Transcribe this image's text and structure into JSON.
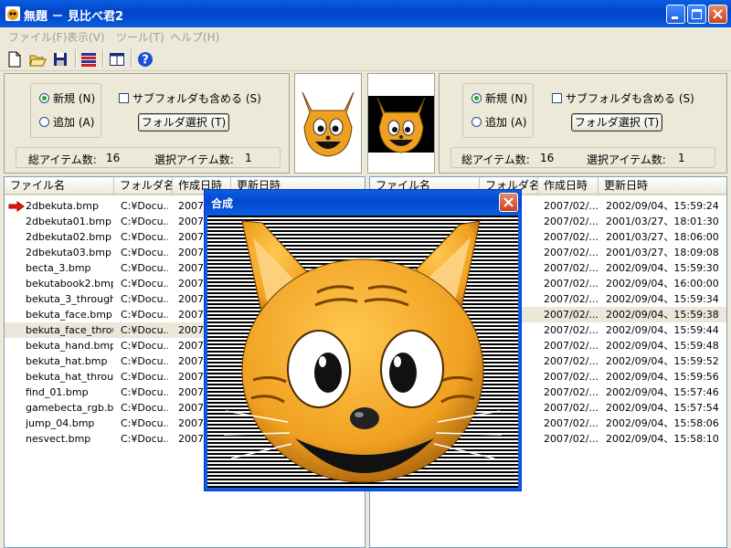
{
  "window": {
    "title": "無題 － 見比べ君2"
  },
  "menu": [
    {
      "label": "ファイル(F)"
    },
    {
      "label": "表示(V)"
    },
    {
      "label": "ツール(T)"
    },
    {
      "label": "ヘルプ(H)"
    }
  ],
  "toolbar": {
    "icons": [
      "new-file-icon",
      "open-folder-icon",
      "save-icon",
      "list-view-icon",
      "split-view-icon",
      "help-icon"
    ]
  },
  "left_panel": {
    "radio_new": "新規 (N)",
    "radio_add": "追加 (A)",
    "subfolder": "サブフォルダも含める (S)",
    "folder_button": "フォルダ選択 (T)",
    "total_label": "総アイテム数:",
    "total_value": "16",
    "selected_label": "選択アイテム数:",
    "selected_value": "1"
  },
  "right_panel": {
    "radio_new": "新規 (N)",
    "radio_add": "追加 (A)",
    "subfolder": "サブフォルダも含める (S)",
    "folder_button": "フォルダ選択 (T)",
    "total_label": "総アイテム数:",
    "total_value": "16",
    "selected_label": "選択アイテム数:",
    "selected_value": "1"
  },
  "left_list": {
    "columns": [
      "ファイル名",
      "フォルダ名",
      "作成日時",
      "更新日時"
    ],
    "rows": [
      {
        "name": "2dbekuta.bmp",
        "folder": "C:¥Docu...",
        "created": "2007/..."
      },
      {
        "name": "2dbekuta01.bmp",
        "folder": "C:¥Docu...",
        "created": "2007/..."
      },
      {
        "name": "2dbekuta02.bmp",
        "folder": "C:¥Docu...",
        "created": "2007/..."
      },
      {
        "name": "2dbekuta03.bmp",
        "folder": "C:¥Docu...",
        "created": "2007/..."
      },
      {
        "name": "becta_3.bmp",
        "folder": "C:¥Docu...",
        "created": "2007/..."
      },
      {
        "name": "bekutabook2.bmp",
        "folder": "C:¥Docu...",
        "created": "2007/..."
      },
      {
        "name": "bekuta_3_through...",
        "folder": "C:¥Docu...",
        "created": "2007/..."
      },
      {
        "name": "bekuta_face.bmp",
        "folder": "C:¥Docu...",
        "created": "2007/..."
      },
      {
        "name": "bekuta_face_throu...",
        "folder": "C:¥Docu...",
        "created": "2007/..."
      },
      {
        "name": "bekuta_hand.bmp",
        "folder": "C:¥Docu...",
        "created": "2007/..."
      },
      {
        "name": "bekuta_hat.bmp",
        "folder": "C:¥Docu...",
        "created": "2007/..."
      },
      {
        "name": "bekuta_hat_throug...",
        "folder": "C:¥Docu...",
        "created": "2007/..."
      },
      {
        "name": "find_01.bmp",
        "folder": "C:¥Docu...",
        "created": "2007/..."
      },
      {
        "name": "gamebecta_rgb.b...",
        "folder": "C:¥Docu...",
        "created": "2007/..."
      },
      {
        "name": "jump_04.bmp",
        "folder": "C:¥Docu...",
        "created": "2007/..."
      },
      {
        "name": "nesvect.bmp",
        "folder": "C:¥Docu...",
        "created": "2007/..."
      }
    ]
  },
  "right_list": {
    "columns": [
      "ファイル名",
      "フォルダ名",
      "作成日時",
      "更新日時"
    ],
    "rows": [
      {
        "created": "2007/02/...",
        "modified": "2002/09/04、15:59:24"
      },
      {
        "created": "2007/02/...",
        "modified": "2001/03/27、18:01:30"
      },
      {
        "created": "2007/02/...",
        "modified": "2001/03/27、18:06:00"
      },
      {
        "created": "2007/02/...",
        "modified": "2001/03/27、18:09:08"
      },
      {
        "created": "2007/02/...",
        "modified": "2002/09/04、15:59:30"
      },
      {
        "created": "2007/02/...",
        "modified": "2002/09/04、16:00:00"
      },
      {
        "created": "2007/02/...",
        "modified": "2002/09/04、15:59:34"
      },
      {
        "created": "2007/02/...",
        "modified": "2002/09/04、15:59:38"
      },
      {
        "created": "2007/02/...",
        "modified": "2002/09/04、15:59:44"
      },
      {
        "created": "2007/02/...",
        "modified": "2002/09/04、15:59:48"
      },
      {
        "created": "2007/02/...",
        "modified": "2002/09/04、15:59:52"
      },
      {
        "created": "2007/02/...",
        "modified": "2002/09/04、15:59:56"
      },
      {
        "created": "2007/02/...",
        "modified": "2002/09/04、15:57:46"
      },
      {
        "created": "2007/02/...",
        "modified": "2002/09/04、15:57:54"
      },
      {
        "created": "2007/02/...",
        "modified": "2002/09/04、15:58:06"
      },
      {
        "created": "2007/02/...",
        "modified": "2002/09/04、15:58:10"
      }
    ]
  },
  "dialog": {
    "title": "合成"
  },
  "colors": {
    "titlebar": "#0a5ee0",
    "cat_orange": "#f0a020",
    "window_bg": "#ece9d8"
  }
}
